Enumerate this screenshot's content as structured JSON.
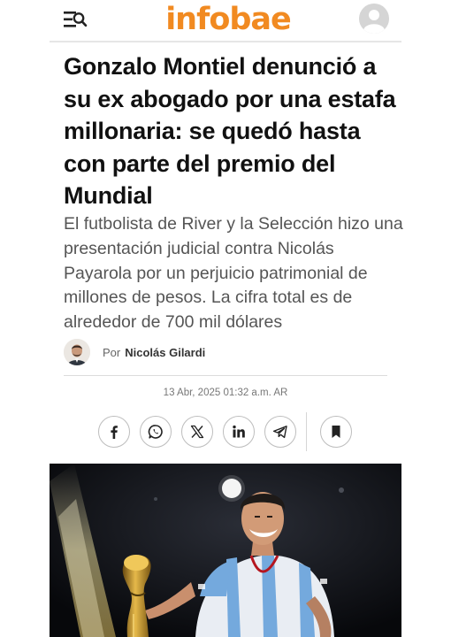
{
  "header": {
    "logo_text": "infobae",
    "brand_color": "#f18a21",
    "menu_icon": "menu-search-icon",
    "account_icon": "user-avatar-icon"
  },
  "article": {
    "headline": "Gonzalo Montiel denunció a su ex abogado por una estafa millonaria: se quedó hasta con parte del premio del Mundial",
    "subtitle": "El futbolista de River y la Selección hizo una presentación judicial contra Nicolás Payarola por un perjuicio patrimonial de millones de pesos. La cifra total es de alrededor de 700 mil dólares",
    "by_prefix": "Por",
    "author": "Nicolás Gilardi",
    "date": "13 Abr, 2025 01:32 a.m. AR"
  },
  "share": {
    "buttons": [
      {
        "icon": "facebook-icon"
      },
      {
        "icon": "whatsapp-icon"
      },
      {
        "icon": "x-twitter-icon"
      },
      {
        "icon": "linkedin-icon"
      },
      {
        "icon": "telegram-icon"
      },
      {
        "icon": "bookmark-icon"
      }
    ]
  }
}
